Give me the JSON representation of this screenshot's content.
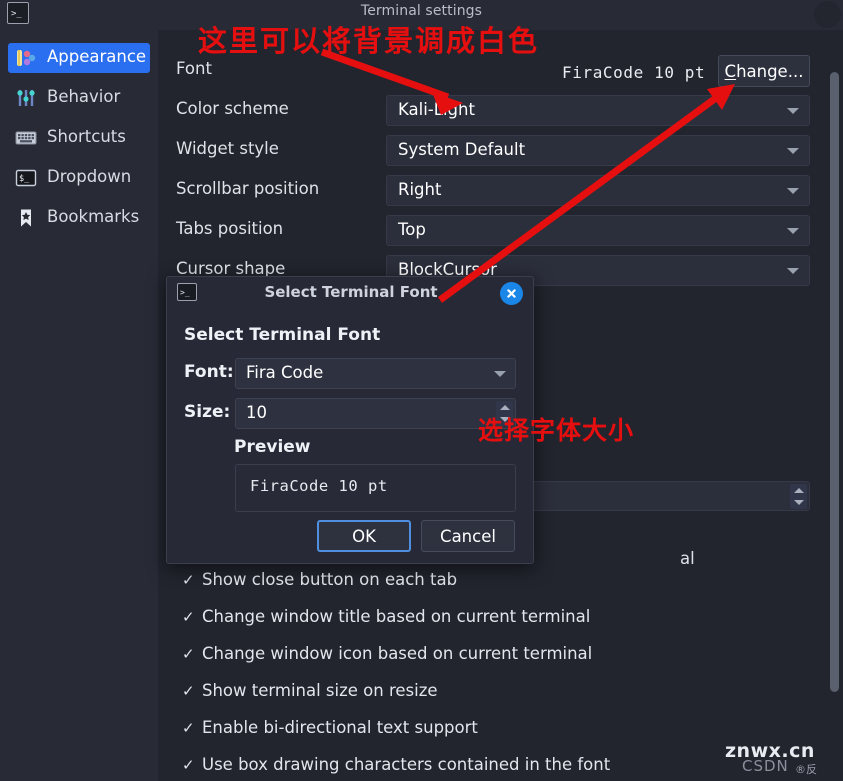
{
  "window": {
    "title": "Terminal settings",
    "icon": "terminal-icon"
  },
  "sidebar": {
    "items": [
      {
        "label": "Appearance",
        "icon": "palette-icon",
        "selected": true
      },
      {
        "label": "Behavior",
        "icon": "sliders-icon",
        "selected": false
      },
      {
        "label": "Shortcuts",
        "icon": "keyboard-icon",
        "selected": false
      },
      {
        "label": "Dropdown",
        "icon": "terminal-icon",
        "selected": false
      },
      {
        "label": "Bookmarks",
        "icon": "bookmark-star-icon",
        "selected": false
      }
    ]
  },
  "settings": {
    "rows": [
      {
        "label": "Font",
        "value": "FiraCode 10 pt",
        "kind": "font"
      },
      {
        "label": "Color scheme",
        "value": "Kali-Light",
        "kind": "combo"
      },
      {
        "label": "Widget style",
        "value": "System Default",
        "kind": "combo"
      },
      {
        "label": "Scrollbar position",
        "value": "Right",
        "kind": "combo"
      },
      {
        "label": "Tabs position",
        "value": "Top",
        "kind": "combo"
      },
      {
        "label": "Cursor shape",
        "value": "BlockCursor",
        "kind": "combo"
      }
    ],
    "change_button": "Change...",
    "change_button_mnemonic": "C",
    "change_button_rest": "hange...",
    "obscured_label_tail": "al",
    "checkboxes": [
      {
        "label": "Show close button on each tab",
        "checked": true
      },
      {
        "label": "Change window title based on current terminal",
        "checked": true
      },
      {
        "label": "Change window icon based on current terminal",
        "checked": true
      },
      {
        "label": "Show terminal size on resize",
        "checked": true
      },
      {
        "label": "Enable bi-directional text support",
        "checked": true
      },
      {
        "label": "Use box drawing characters contained in the font",
        "checked": true
      }
    ],
    "check_mark": "✓"
  },
  "dialog": {
    "title": "Select Terminal Font",
    "icon": "terminal-icon",
    "close_icon": "close-icon",
    "heading": "Select Terminal Font",
    "font_label": "Font:",
    "font_value": "Fira Code",
    "size_label": "Size:",
    "size_value": "10",
    "preview_label": "Preview",
    "preview_text": "FiraCode 10 pt",
    "ok_label": "OK",
    "cancel_label": "Cancel"
  },
  "annotations": [
    {
      "text": "这里可以将背景调成白色",
      "color": "#e60f0f"
    },
    {
      "text": "选择字体大小",
      "color": "#e60f0f"
    }
  ],
  "watermark": {
    "primary": "znwx.cn",
    "secondary": "CSDN",
    "badge": "®反"
  },
  "colors": {
    "accent": "#2a6ff0",
    "annotation": "#e60f0f",
    "close": "#1a86e8",
    "sidebar_bg": "#282a36",
    "content_bg": "#22242e"
  }
}
